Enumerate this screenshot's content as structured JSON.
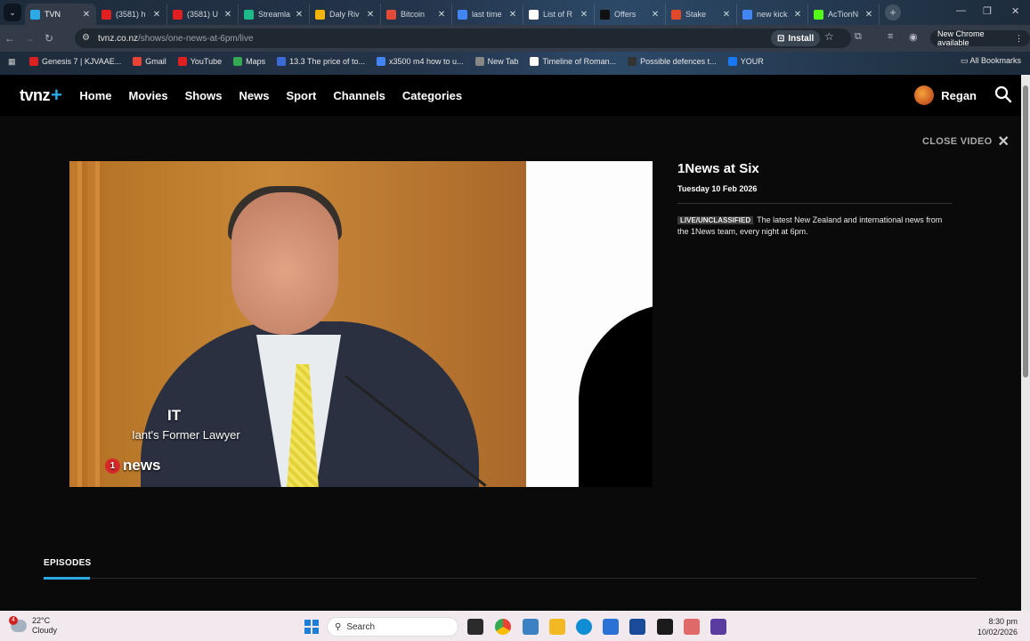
{
  "browser": {
    "tabs": [
      {
        "label": "TVN",
        "color": "#2aa9e6",
        "active": true
      },
      {
        "label": "(3581) h",
        "color": "#e02020"
      },
      {
        "label": "(3581) U",
        "color": "#e02020"
      },
      {
        "label": "Streamla",
        "color": "#1db98a"
      },
      {
        "label": "Daly Riv",
        "color": "#f4b400"
      },
      {
        "label": "Bitcoin",
        "color": "#e24a3a"
      },
      {
        "label": "last time",
        "color": "#4285f4"
      },
      {
        "label": "List of R",
        "color": "#ffffff"
      },
      {
        "label": "Offers",
        "color": "#111111"
      },
      {
        "label": "Stake",
        "color": "#e04a2a"
      },
      {
        "label": "new kick",
        "color": "#4285f4"
      },
      {
        "label": "AcTionN",
        "color": "#53fc18"
      }
    ],
    "url_host": "tvnz.co.nz",
    "url_path": "/shows/one-news-at-6pm/live",
    "install_label": "Install",
    "new_chrome_label": "New Chrome available",
    "bookmarks": [
      {
        "label": "Genesis 7 | KJVAAE...",
        "color": "#e02020"
      },
      {
        "label": "Gmail",
        "color": "#ea4335"
      },
      {
        "label": "YouTube",
        "color": "#e02020"
      },
      {
        "label": "Maps",
        "color": "#34a853"
      },
      {
        "label": "13.3 The price of to...",
        "color": "#3a6ad6"
      },
      {
        "label": "x3500 m4 how to u...",
        "color": "#4285f4"
      },
      {
        "label": "New Tab",
        "color": "#888888"
      },
      {
        "label": "Timeline of Roman...",
        "color": "#ffffff"
      },
      {
        "label": "Possible defences t...",
        "color": "#333333"
      },
      {
        "label": "YOUR",
        "color": "#1877f2"
      }
    ],
    "all_bookmarks_label": "All Bookmarks"
  },
  "site": {
    "logo": "tvnz",
    "logo_plus": "+",
    "nav": [
      "Home",
      "Movies",
      "Shows",
      "News",
      "Sport",
      "Channels",
      "Categories"
    ],
    "user_name": "Regan",
    "close_video_label": "CLOSE VIDEO",
    "video": {
      "caption_title": "IT",
      "caption_subtitle": "Iant's Former Lawyer",
      "channel_logo": "news",
      "channel_number": "1"
    },
    "show": {
      "title": "1News at Six",
      "date": "Tuesday 10 Feb 2026",
      "tag": "LIVE/UNCLASSIFIED",
      "description": "The latest New Zealand and international news from the 1News team, every night at 6pm."
    },
    "episodes_label": "EPISODES",
    "accent_color": "#2aa9e6"
  },
  "taskbar": {
    "weather_temp": "22°C",
    "weather_desc": "Cloudy",
    "weather_badge": "4",
    "search_label": "Search",
    "time": "8:30 pm",
    "date": "10/02/2026"
  }
}
